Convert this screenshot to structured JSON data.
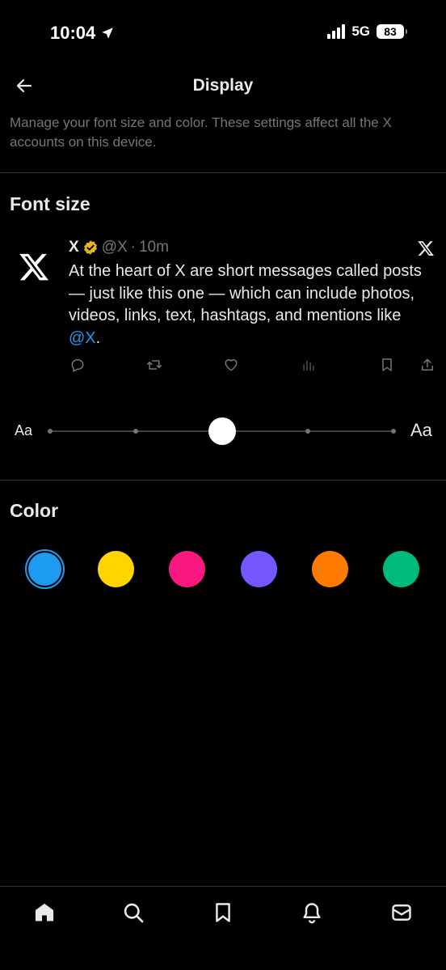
{
  "status_bar": {
    "time": "10:04",
    "network": "5G",
    "battery": "83"
  },
  "header": {
    "title": "Display"
  },
  "description": "Manage your font size and color. These settings affect all the X accounts on this device.",
  "font_size": {
    "title": "Font size",
    "small_label": "Aa",
    "large_label": "Aa",
    "steps": 5,
    "selected_step": 2
  },
  "post": {
    "name": "X",
    "handle": "@X",
    "separator": "·",
    "time": "10m",
    "text_before": "At the heart of X are short messages called posts — just like this one — which can include photos, videos, links, text, hashtags, and mentions like ",
    "mention": "@X",
    "text_after": "."
  },
  "color": {
    "title": "Color",
    "selected": 0,
    "options": [
      "#1d9bf0",
      "#ffd400",
      "#f91880",
      "#7856ff",
      "#ff7a00",
      "#00ba7c"
    ]
  },
  "icons": {
    "back": "arrow-left-icon",
    "verified": "gold-verified-badge-icon",
    "post_actions": [
      "reply-icon",
      "repost-icon",
      "like-icon",
      "views-icon",
      "bookmark-icon",
      "share-icon"
    ],
    "nav": [
      "home-icon",
      "search-icon",
      "bookmark-icon",
      "notifications-icon",
      "messages-icon"
    ]
  }
}
